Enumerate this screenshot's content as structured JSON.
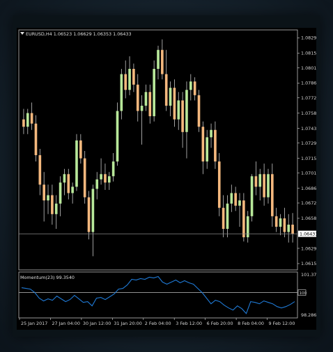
{
  "window": {
    "header": "EURUSD,H4  1.06523 1.06629 1.06353 1.06433",
    "menu_icon": "triangle-down-icon"
  },
  "colors": {
    "background": "#000000",
    "bull": "#b8e89a",
    "bear": "#f4b87e",
    "grid": "#bfbfbf",
    "momentum_line": "#1f7ad6",
    "text": "#d6d6d6"
  },
  "price_axis": {
    "ticks": [
      "1.08295",
      "1.08150",
      "1.08010",
      "1.07865",
      "1.07725",
      "1.07580",
      "1.07435",
      "1.07295",
      "1.07150",
      "1.07010",
      "1.06865",
      "1.06725",
      "1.06580",
      "1.06433",
      "1.06295",
      "1.06150"
    ],
    "current_price_label": "1.06433"
  },
  "momentum": {
    "label": "Momentum(23) 99.3540",
    "top_tick": "101.3742",
    "level_tick": "100",
    "bottom_tick": "98.2866"
  },
  "time_axis": {
    "ticks": [
      "25 Jan 2017",
      "27 Jan 04:00",
      "30 Jan 12:00",
      "31 Jan 20:00",
      "2 Feb 04:00",
      "3 Feb 12:00",
      "6 Feb 20:00",
      "8 Feb 04:00",
      "9 Feb 12:00"
    ]
  },
  "chart_data": [
    {
      "type": "candlestick",
      "symbol": "EURUSD",
      "timeframe": "H4",
      "title": "EURUSD,H4  1.06523 1.06629 1.06353 1.06433",
      "ohlc_last": {
        "open": 1.06523,
        "high": 1.06629,
        "low": 1.06353,
        "close": 1.06433
      },
      "ylim": [
        1.0609,
        1.0837
      ],
      "current_price": 1.06433,
      "x_ticks": [
        "25 Jan 2017",
        "27 Jan 04:00",
        "30 Jan 12:00",
        "31 Jan 20:00",
        "2 Feb 04:00",
        "3 Feb 12:00",
        "6 Feb 20:00",
        "8 Feb 04:00",
        "9 Feb 12:00"
      ],
      "candles": [
        {
          "o": 1.0752,
          "h": 1.0762,
          "l": 1.0738,
          "c": 1.0745
        },
        {
          "o": 1.0745,
          "h": 1.0762,
          "l": 1.0738,
          "c": 1.0758
        },
        {
          "o": 1.0758,
          "h": 1.0768,
          "l": 1.0742,
          "c": 1.0748
        },
        {
          "o": 1.0748,
          "h": 1.0756,
          "l": 1.0712,
          "c": 1.0718
        },
        {
          "o": 1.0718,
          "h": 1.0724,
          "l": 1.068,
          "c": 1.069
        },
        {
          "o": 1.069,
          "h": 1.0702,
          "l": 1.0655,
          "c": 1.0675
        },
        {
          "o": 1.0675,
          "h": 1.069,
          "l": 1.0662,
          "c": 1.068
        },
        {
          "o": 1.068,
          "h": 1.069,
          "l": 1.0652,
          "c": 1.0662
        },
        {
          "o": 1.0662,
          "h": 1.068,
          "l": 1.0648,
          "c": 1.0672
        },
        {
          "o": 1.0672,
          "h": 1.0698,
          "l": 1.066,
          "c": 1.0692
        },
        {
          "o": 1.0692,
          "h": 1.0705,
          "l": 1.068,
          "c": 1.07
        },
        {
          "o": 1.07,
          "h": 1.0705,
          "l": 1.0676,
          "c": 1.0682
        },
        {
          "o": 1.0682,
          "h": 1.0692,
          "l": 1.0672,
          "c": 1.0688
        },
        {
          "o": 1.0688,
          "h": 1.0738,
          "l": 1.0684,
          "c": 1.0732
        },
        {
          "o": 1.0732,
          "h": 1.0738,
          "l": 1.071,
          "c": 1.0715
        },
        {
          "o": 1.0715,
          "h": 1.0722,
          "l": 1.0672,
          "c": 1.0678
        },
        {
          "o": 1.0678,
          "h": 1.0684,
          "l": 1.0638,
          "c": 1.0645
        },
        {
          "o": 1.0645,
          "h": 1.069,
          "l": 1.0622,
          "c": 1.0686
        },
        {
          "o": 1.0686,
          "h": 1.0702,
          "l": 1.0676,
          "c": 1.0695
        },
        {
          "o": 1.0695,
          "h": 1.0715,
          "l": 1.069,
          "c": 1.07
        },
        {
          "o": 1.07,
          "h": 1.071,
          "l": 1.0685,
          "c": 1.0692
        },
        {
          "o": 1.0692,
          "h": 1.0702,
          "l": 1.0685,
          "c": 1.0698
        },
        {
          "o": 1.0698,
          "h": 1.072,
          "l": 1.0693,
          "c": 1.0712
        },
        {
          "o": 1.0712,
          "h": 1.0768,
          "l": 1.0708,
          "c": 1.076
        },
        {
          "o": 1.076,
          "h": 1.08,
          "l": 1.0752,
          "c": 1.0795
        },
        {
          "o": 1.0795,
          "h": 1.0808,
          "l": 1.0772,
          "c": 1.078
        },
        {
          "o": 1.078,
          "h": 1.0812,
          "l": 1.0775,
          "c": 1.08
        },
        {
          "o": 1.08,
          "h": 1.0805,
          "l": 1.0778,
          "c": 1.0785
        },
        {
          "o": 1.0785,
          "h": 1.0795,
          "l": 1.075,
          "c": 1.076
        },
        {
          "o": 1.076,
          "h": 1.0775,
          "l": 1.0728,
          "c": 1.0765
        },
        {
          "o": 1.0765,
          "h": 1.0785,
          "l": 1.076,
          "c": 1.0778
        },
        {
          "o": 1.0778,
          "h": 1.0785,
          "l": 1.0748,
          "c": 1.0755
        },
        {
          "o": 1.0755,
          "h": 1.0808,
          "l": 1.075,
          "c": 1.08
        },
        {
          "o": 1.08,
          "h": 1.0822,
          "l": 1.079,
          "c": 1.0818
        },
        {
          "o": 1.0818,
          "h": 1.0828,
          "l": 1.079,
          "c": 1.0795
        },
        {
          "o": 1.0795,
          "h": 1.0818,
          "l": 1.076,
          "c": 1.0765
        },
        {
          "o": 1.0765,
          "h": 1.0788,
          "l": 1.0755,
          "c": 1.0782
        },
        {
          "o": 1.0782,
          "h": 1.079,
          "l": 1.0745,
          "c": 1.0752
        },
        {
          "o": 1.0752,
          "h": 1.0778,
          "l": 1.0742,
          "c": 1.077
        },
        {
          "o": 1.077,
          "h": 1.0778,
          "l": 1.0725,
          "c": 1.074
        },
        {
          "o": 1.074,
          "h": 1.0788,
          "l": 1.0715,
          "c": 1.078
        },
        {
          "o": 1.078,
          "h": 1.0795,
          "l": 1.077,
          "c": 1.0788
        },
        {
          "o": 1.0788,
          "h": 1.0792,
          "l": 1.077,
          "c": 1.0775
        },
        {
          "o": 1.0775,
          "h": 1.078,
          "l": 1.074,
          "c": 1.0745
        },
        {
          "o": 1.0745,
          "h": 1.075,
          "l": 1.07,
          "c": 1.0712
        },
        {
          "o": 1.0712,
          "h": 1.0742,
          "l": 1.0705,
          "c": 1.0735
        },
        {
          "o": 1.0735,
          "h": 1.0748,
          "l": 1.0725,
          "c": 1.0742
        },
        {
          "o": 1.0742,
          "h": 1.075,
          "l": 1.0705,
          "c": 1.0712
        },
        {
          "o": 1.0712,
          "h": 1.072,
          "l": 1.066,
          "c": 1.0668
        },
        {
          "o": 1.0668,
          "h": 1.068,
          "l": 1.064,
          "c": 1.0648
        },
        {
          "o": 1.0648,
          "h": 1.068,
          "l": 1.064,
          "c": 1.0672
        },
        {
          "o": 1.0672,
          "h": 1.069,
          "l": 1.0664,
          "c": 1.0682
        },
        {
          "o": 1.0682,
          "h": 1.0688,
          "l": 1.0665,
          "c": 1.067
        },
        {
          "o": 1.067,
          "h": 1.0682,
          "l": 1.065,
          "c": 1.0675
        },
        {
          "o": 1.0675,
          "h": 1.0682,
          "l": 1.0636,
          "c": 1.064
        },
        {
          "o": 1.064,
          "h": 1.0665,
          "l": 1.0635,
          "c": 1.066
        },
        {
          "o": 1.066,
          "h": 1.07,
          "l": 1.0655,
          "c": 1.0698
        },
        {
          "o": 1.0698,
          "h": 1.0712,
          "l": 1.068,
          "c": 1.0688
        },
        {
          "o": 1.0688,
          "h": 1.0705,
          "l": 1.0675,
          "c": 1.07
        },
        {
          "o": 1.07,
          "h": 1.071,
          "l": 1.067,
          "c": 1.0678
        },
        {
          "o": 1.0678,
          "h": 1.0705,
          "l": 1.0672,
          "c": 1.07
        },
        {
          "o": 1.07,
          "h": 1.071,
          "l": 1.065,
          "c": 1.066
        },
        {
          "o": 1.066,
          "h": 1.0668,
          "l": 1.0645,
          "c": 1.065
        },
        {
          "o": 1.065,
          "h": 1.0662,
          "l": 1.0642,
          "c": 1.0658
        },
        {
          "o": 1.0658,
          "h": 1.0668,
          "l": 1.064,
          "c": 1.0645
        },
        {
          "o": 1.0645,
          "h": 1.0662,
          "l": 1.0635,
          "c": 1.0652
        },
        {
          "o": 1.0652,
          "h": 1.0663,
          "l": 1.0635,
          "c": 1.0643
        }
      ]
    },
    {
      "type": "line",
      "name": "Momentum(23)",
      "last_value": 99.354,
      "reference_level": 100,
      "ylim": [
        98.2866,
        101.3742
      ],
      "values": [
        100.35,
        100.3,
        100.25,
        100.0,
        99.6,
        99.4,
        99.55,
        99.45,
        99.75,
        99.55,
        99.35,
        99.5,
        99.8,
        99.55,
        99.3,
        99.35,
        99.05,
        99.6,
        99.65,
        99.5,
        99.7,
        99.9,
        100.25,
        100.3,
        100.55,
        100.95,
        100.9,
        101.0,
        100.95,
        101.1,
        101.05,
        101.15,
        100.75,
        100.6,
        100.75,
        100.9,
        100.7,
        100.85,
        100.7,
        100.6,
        100.3,
        100.0,
        99.6,
        99.2,
        99.45,
        99.35,
        99.1,
        98.9,
        98.75,
        99.05,
        98.85,
        98.5,
        99.35,
        99.3,
        99.2,
        99.4,
        99.3,
        99.2,
        99.0,
        98.9,
        99.0,
        99.15,
        99.354
      ]
    }
  ]
}
